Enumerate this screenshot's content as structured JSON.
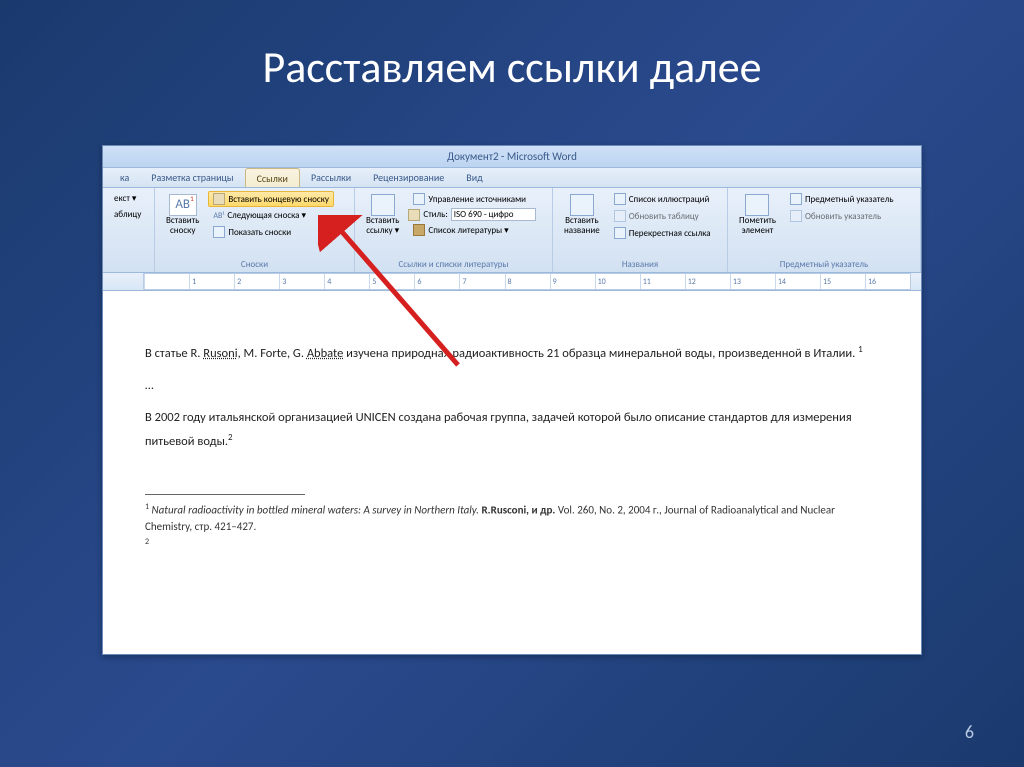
{
  "slide": {
    "title": "Расставляем ссылки далее",
    "page_number": "6"
  },
  "word": {
    "title": "Документ2 - Microsoft Word",
    "tabs": [
      "Разметка страницы",
      "Ссылки",
      "Рассылки",
      "Рецензирование",
      "Вид"
    ],
    "active_tab_index": 1,
    "partial_tab_left": "ка",
    "ribbon": {
      "group0": {
        "btn1": "екст ▾",
        "btn2": "аблицу",
        "label": ""
      },
      "snoski": {
        "big_label": "Вставить\nсноску",
        "endnote": "Вставить концевую сноску",
        "next": "Следующая сноска ▾",
        "show": "Показать сноски",
        "label": "Сноски"
      },
      "citations": {
        "big_label": "Вставить\nссылку ▾",
        "manage": "Управление источниками",
        "style_label": "Стиль:",
        "style_value": "ISO 690 - цифро",
        "biblio": "Список литературы ▾",
        "label": "Ссылки и списки литературы"
      },
      "captions": {
        "big_label": "Вставить\nназвание",
        "illus": "Список иллюстраций",
        "update": "Обновить таблицу",
        "cross": "Перекрестная ссылка",
        "label": "Названия"
      },
      "index": {
        "big_label": "Пометить\nэлемент",
        "subj": "Предметный указатель",
        "update": "Обновить указатель",
        "label": "Предметный указатель"
      }
    },
    "ruler_numbers": [
      "",
      "1",
      "2",
      "3",
      "4",
      "5",
      "6",
      "7",
      "8",
      "9",
      "10",
      "11",
      "12",
      "13",
      "14",
      "15",
      "16"
    ],
    "document": {
      "p1_a": "В статье R. ",
      "p1_rusoni": "Rusoni",
      "p1_b": ", M. Forte, G. ",
      "p1_abbate": "Abbate",
      "p1_c": " изучена природная радиоактивность 21 образца минеральной воды, произведенной в Италии. ",
      "p1_sup": "1",
      "p2": "…",
      "p3": "В 2002 году итальянской организацией UNICEN создана рабочая группа, задачей которой было описание стандартов для измерения питьевой воды.",
      "p3_sup": "2",
      "fn1_sup": "1",
      "fn1_italic": " Natural radioactivity in bottled mineral waters: A survey in Northern Italy.",
      "fn1_bold": " R.Rusconi, и др.",
      "fn1_rest": " Vol. 260, No. 2, 2004 г., Journal of Radioanalytical and Nuclear Chemistry, стр. 421–427.",
      "fn2_sup": "2"
    }
  }
}
